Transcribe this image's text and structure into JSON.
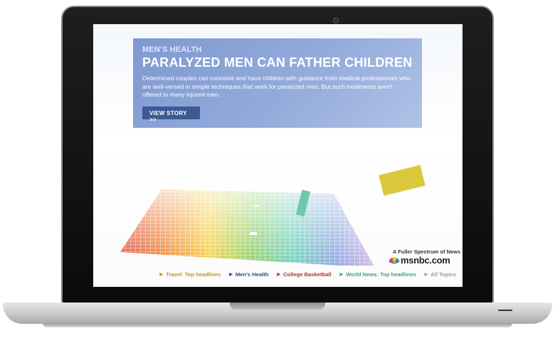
{
  "hero": {
    "kicker": "MEN'S HEALTH",
    "headline": "PARALYZED MEN CAN FATHER CHILDREN",
    "description": "Determined couples can conceive and have children with guidance from medical professionals who are well-versed in simple techniques that work for paralyzed men. But such treatments aren't offered to many injured men.",
    "cta_label": "VIEW STORY  >>",
    "background_color": "#8ea7d9",
    "cta_color": "#3c5a94"
  },
  "brand": {
    "tagline": "A Fuller Spectrum of News",
    "name": "msnbc.com"
  },
  "footer_nav": [
    {
      "label": "Travel: Top headlines",
      "color": "#b49a2a",
      "icon": "triangle-right-icon"
    },
    {
      "label": "Men's Health",
      "color": "#2e4d8f",
      "icon": "triangle-right-icon"
    },
    {
      "label": "College Basketball",
      "color": "#b6342b",
      "icon": "triangle-right-icon"
    },
    {
      "label": "World News: Top headlines",
      "color": "#3fa37c",
      "icon": "triangle-right-icon"
    },
    {
      "label": "All Topics",
      "color": "#9a9a9a",
      "icon": "triangle-right-icon"
    }
  ]
}
